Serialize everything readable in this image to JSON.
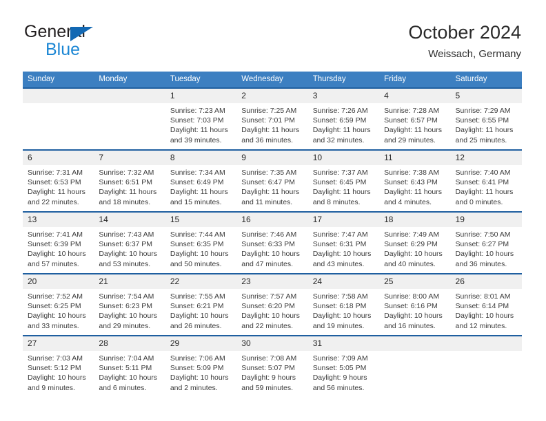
{
  "branding": {
    "logo_text_top": "General",
    "logo_text_bottom": "Blue",
    "logo_accent_color": "#1268b3",
    "logo_blue_color": "#1b86d4"
  },
  "header": {
    "title": "October 2024",
    "subtitle": "Weissach, Germany"
  },
  "theme": {
    "header_row_bg": "#3c7fc1",
    "row_border": "#1f5fa0",
    "daynum_bg": "#f0f0f0"
  },
  "calendar": {
    "weekday_headers": [
      "Sunday",
      "Monday",
      "Tuesday",
      "Wednesday",
      "Thursday",
      "Friday",
      "Saturday"
    ],
    "weeks": [
      [
        {
          "day": "",
          "sunrise": "",
          "sunset": "",
          "daylight": ""
        },
        {
          "day": "",
          "sunrise": "",
          "sunset": "",
          "daylight": ""
        },
        {
          "day": "1",
          "sunrise": "Sunrise: 7:23 AM",
          "sunset": "Sunset: 7:03 PM",
          "daylight": "Daylight: 11 hours and 39 minutes."
        },
        {
          "day": "2",
          "sunrise": "Sunrise: 7:25 AM",
          "sunset": "Sunset: 7:01 PM",
          "daylight": "Daylight: 11 hours and 36 minutes."
        },
        {
          "day": "3",
          "sunrise": "Sunrise: 7:26 AM",
          "sunset": "Sunset: 6:59 PM",
          "daylight": "Daylight: 11 hours and 32 minutes."
        },
        {
          "day": "4",
          "sunrise": "Sunrise: 7:28 AM",
          "sunset": "Sunset: 6:57 PM",
          "daylight": "Daylight: 11 hours and 29 minutes."
        },
        {
          "day": "5",
          "sunrise": "Sunrise: 7:29 AM",
          "sunset": "Sunset: 6:55 PM",
          "daylight": "Daylight: 11 hours and 25 minutes."
        }
      ],
      [
        {
          "day": "6",
          "sunrise": "Sunrise: 7:31 AM",
          "sunset": "Sunset: 6:53 PM",
          "daylight": "Daylight: 11 hours and 22 minutes."
        },
        {
          "day": "7",
          "sunrise": "Sunrise: 7:32 AM",
          "sunset": "Sunset: 6:51 PM",
          "daylight": "Daylight: 11 hours and 18 minutes."
        },
        {
          "day": "8",
          "sunrise": "Sunrise: 7:34 AM",
          "sunset": "Sunset: 6:49 PM",
          "daylight": "Daylight: 11 hours and 15 minutes."
        },
        {
          "day": "9",
          "sunrise": "Sunrise: 7:35 AM",
          "sunset": "Sunset: 6:47 PM",
          "daylight": "Daylight: 11 hours and 11 minutes."
        },
        {
          "day": "10",
          "sunrise": "Sunrise: 7:37 AM",
          "sunset": "Sunset: 6:45 PM",
          "daylight": "Daylight: 11 hours and 8 minutes."
        },
        {
          "day": "11",
          "sunrise": "Sunrise: 7:38 AM",
          "sunset": "Sunset: 6:43 PM",
          "daylight": "Daylight: 11 hours and 4 minutes."
        },
        {
          "day": "12",
          "sunrise": "Sunrise: 7:40 AM",
          "sunset": "Sunset: 6:41 PM",
          "daylight": "Daylight: 11 hours and 0 minutes."
        }
      ],
      [
        {
          "day": "13",
          "sunrise": "Sunrise: 7:41 AM",
          "sunset": "Sunset: 6:39 PM",
          "daylight": "Daylight: 10 hours and 57 minutes."
        },
        {
          "day": "14",
          "sunrise": "Sunrise: 7:43 AM",
          "sunset": "Sunset: 6:37 PM",
          "daylight": "Daylight: 10 hours and 53 minutes."
        },
        {
          "day": "15",
          "sunrise": "Sunrise: 7:44 AM",
          "sunset": "Sunset: 6:35 PM",
          "daylight": "Daylight: 10 hours and 50 minutes."
        },
        {
          "day": "16",
          "sunrise": "Sunrise: 7:46 AM",
          "sunset": "Sunset: 6:33 PM",
          "daylight": "Daylight: 10 hours and 47 minutes."
        },
        {
          "day": "17",
          "sunrise": "Sunrise: 7:47 AM",
          "sunset": "Sunset: 6:31 PM",
          "daylight": "Daylight: 10 hours and 43 minutes."
        },
        {
          "day": "18",
          "sunrise": "Sunrise: 7:49 AM",
          "sunset": "Sunset: 6:29 PM",
          "daylight": "Daylight: 10 hours and 40 minutes."
        },
        {
          "day": "19",
          "sunrise": "Sunrise: 7:50 AM",
          "sunset": "Sunset: 6:27 PM",
          "daylight": "Daylight: 10 hours and 36 minutes."
        }
      ],
      [
        {
          "day": "20",
          "sunrise": "Sunrise: 7:52 AM",
          "sunset": "Sunset: 6:25 PM",
          "daylight": "Daylight: 10 hours and 33 minutes."
        },
        {
          "day": "21",
          "sunrise": "Sunrise: 7:54 AM",
          "sunset": "Sunset: 6:23 PM",
          "daylight": "Daylight: 10 hours and 29 minutes."
        },
        {
          "day": "22",
          "sunrise": "Sunrise: 7:55 AM",
          "sunset": "Sunset: 6:21 PM",
          "daylight": "Daylight: 10 hours and 26 minutes."
        },
        {
          "day": "23",
          "sunrise": "Sunrise: 7:57 AM",
          "sunset": "Sunset: 6:20 PM",
          "daylight": "Daylight: 10 hours and 22 minutes."
        },
        {
          "day": "24",
          "sunrise": "Sunrise: 7:58 AM",
          "sunset": "Sunset: 6:18 PM",
          "daylight": "Daylight: 10 hours and 19 minutes."
        },
        {
          "day": "25",
          "sunrise": "Sunrise: 8:00 AM",
          "sunset": "Sunset: 6:16 PM",
          "daylight": "Daylight: 10 hours and 16 minutes."
        },
        {
          "day": "26",
          "sunrise": "Sunrise: 8:01 AM",
          "sunset": "Sunset: 6:14 PM",
          "daylight": "Daylight: 10 hours and 12 minutes."
        }
      ],
      [
        {
          "day": "27",
          "sunrise": "Sunrise: 7:03 AM",
          "sunset": "Sunset: 5:12 PM",
          "daylight": "Daylight: 10 hours and 9 minutes."
        },
        {
          "day": "28",
          "sunrise": "Sunrise: 7:04 AM",
          "sunset": "Sunset: 5:11 PM",
          "daylight": "Daylight: 10 hours and 6 minutes."
        },
        {
          "day": "29",
          "sunrise": "Sunrise: 7:06 AM",
          "sunset": "Sunset: 5:09 PM",
          "daylight": "Daylight: 10 hours and 2 minutes."
        },
        {
          "day": "30",
          "sunrise": "Sunrise: 7:08 AM",
          "sunset": "Sunset: 5:07 PM",
          "daylight": "Daylight: 9 hours and 59 minutes."
        },
        {
          "day": "31",
          "sunrise": "Sunrise: 7:09 AM",
          "sunset": "Sunset: 5:05 PM",
          "daylight": "Daylight: 9 hours and 56 minutes."
        },
        {
          "day": "",
          "sunrise": "",
          "sunset": "",
          "daylight": ""
        },
        {
          "day": "",
          "sunrise": "",
          "sunset": "",
          "daylight": ""
        }
      ]
    ]
  }
}
